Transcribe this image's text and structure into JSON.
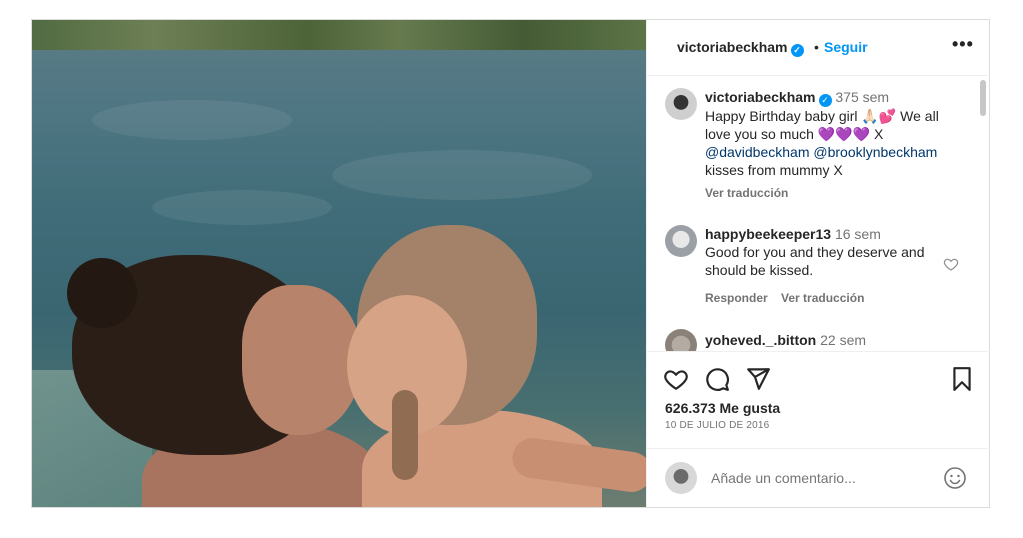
{
  "post": {
    "author": "victoriabeckham",
    "follow_label": "Seguir",
    "separator": "•",
    "more_label": "•••"
  },
  "caption": {
    "author": "victoriabeckham",
    "time": "375 sem",
    "text_part1": "Happy Birthday baby girl 🙏🏻💕 We all love you so much 💜💜💜 X",
    "mention1": "@davidbeckham",
    "mention2": "@brooklynbeckham",
    "text_part2": "kisses from mummy X",
    "translate": "Ver traducción"
  },
  "comments": [
    {
      "author": "happybeekeeper13",
      "time": "16 sem",
      "text": "Good for you and they deserve and should be kissed.",
      "reply": "Responder",
      "translate": "Ver traducción"
    },
    {
      "author": "yoheved._.bitton",
      "time": "22 sem"
    }
  ],
  "likes": "626.373 Me gusta",
  "date": "10 DE JULIO DE 2016",
  "add_comment_placeholder": "Añade un comentario...",
  "colors": {
    "accent": "#0095f6",
    "mention": "#00376b",
    "secondary_text": "#737373"
  }
}
